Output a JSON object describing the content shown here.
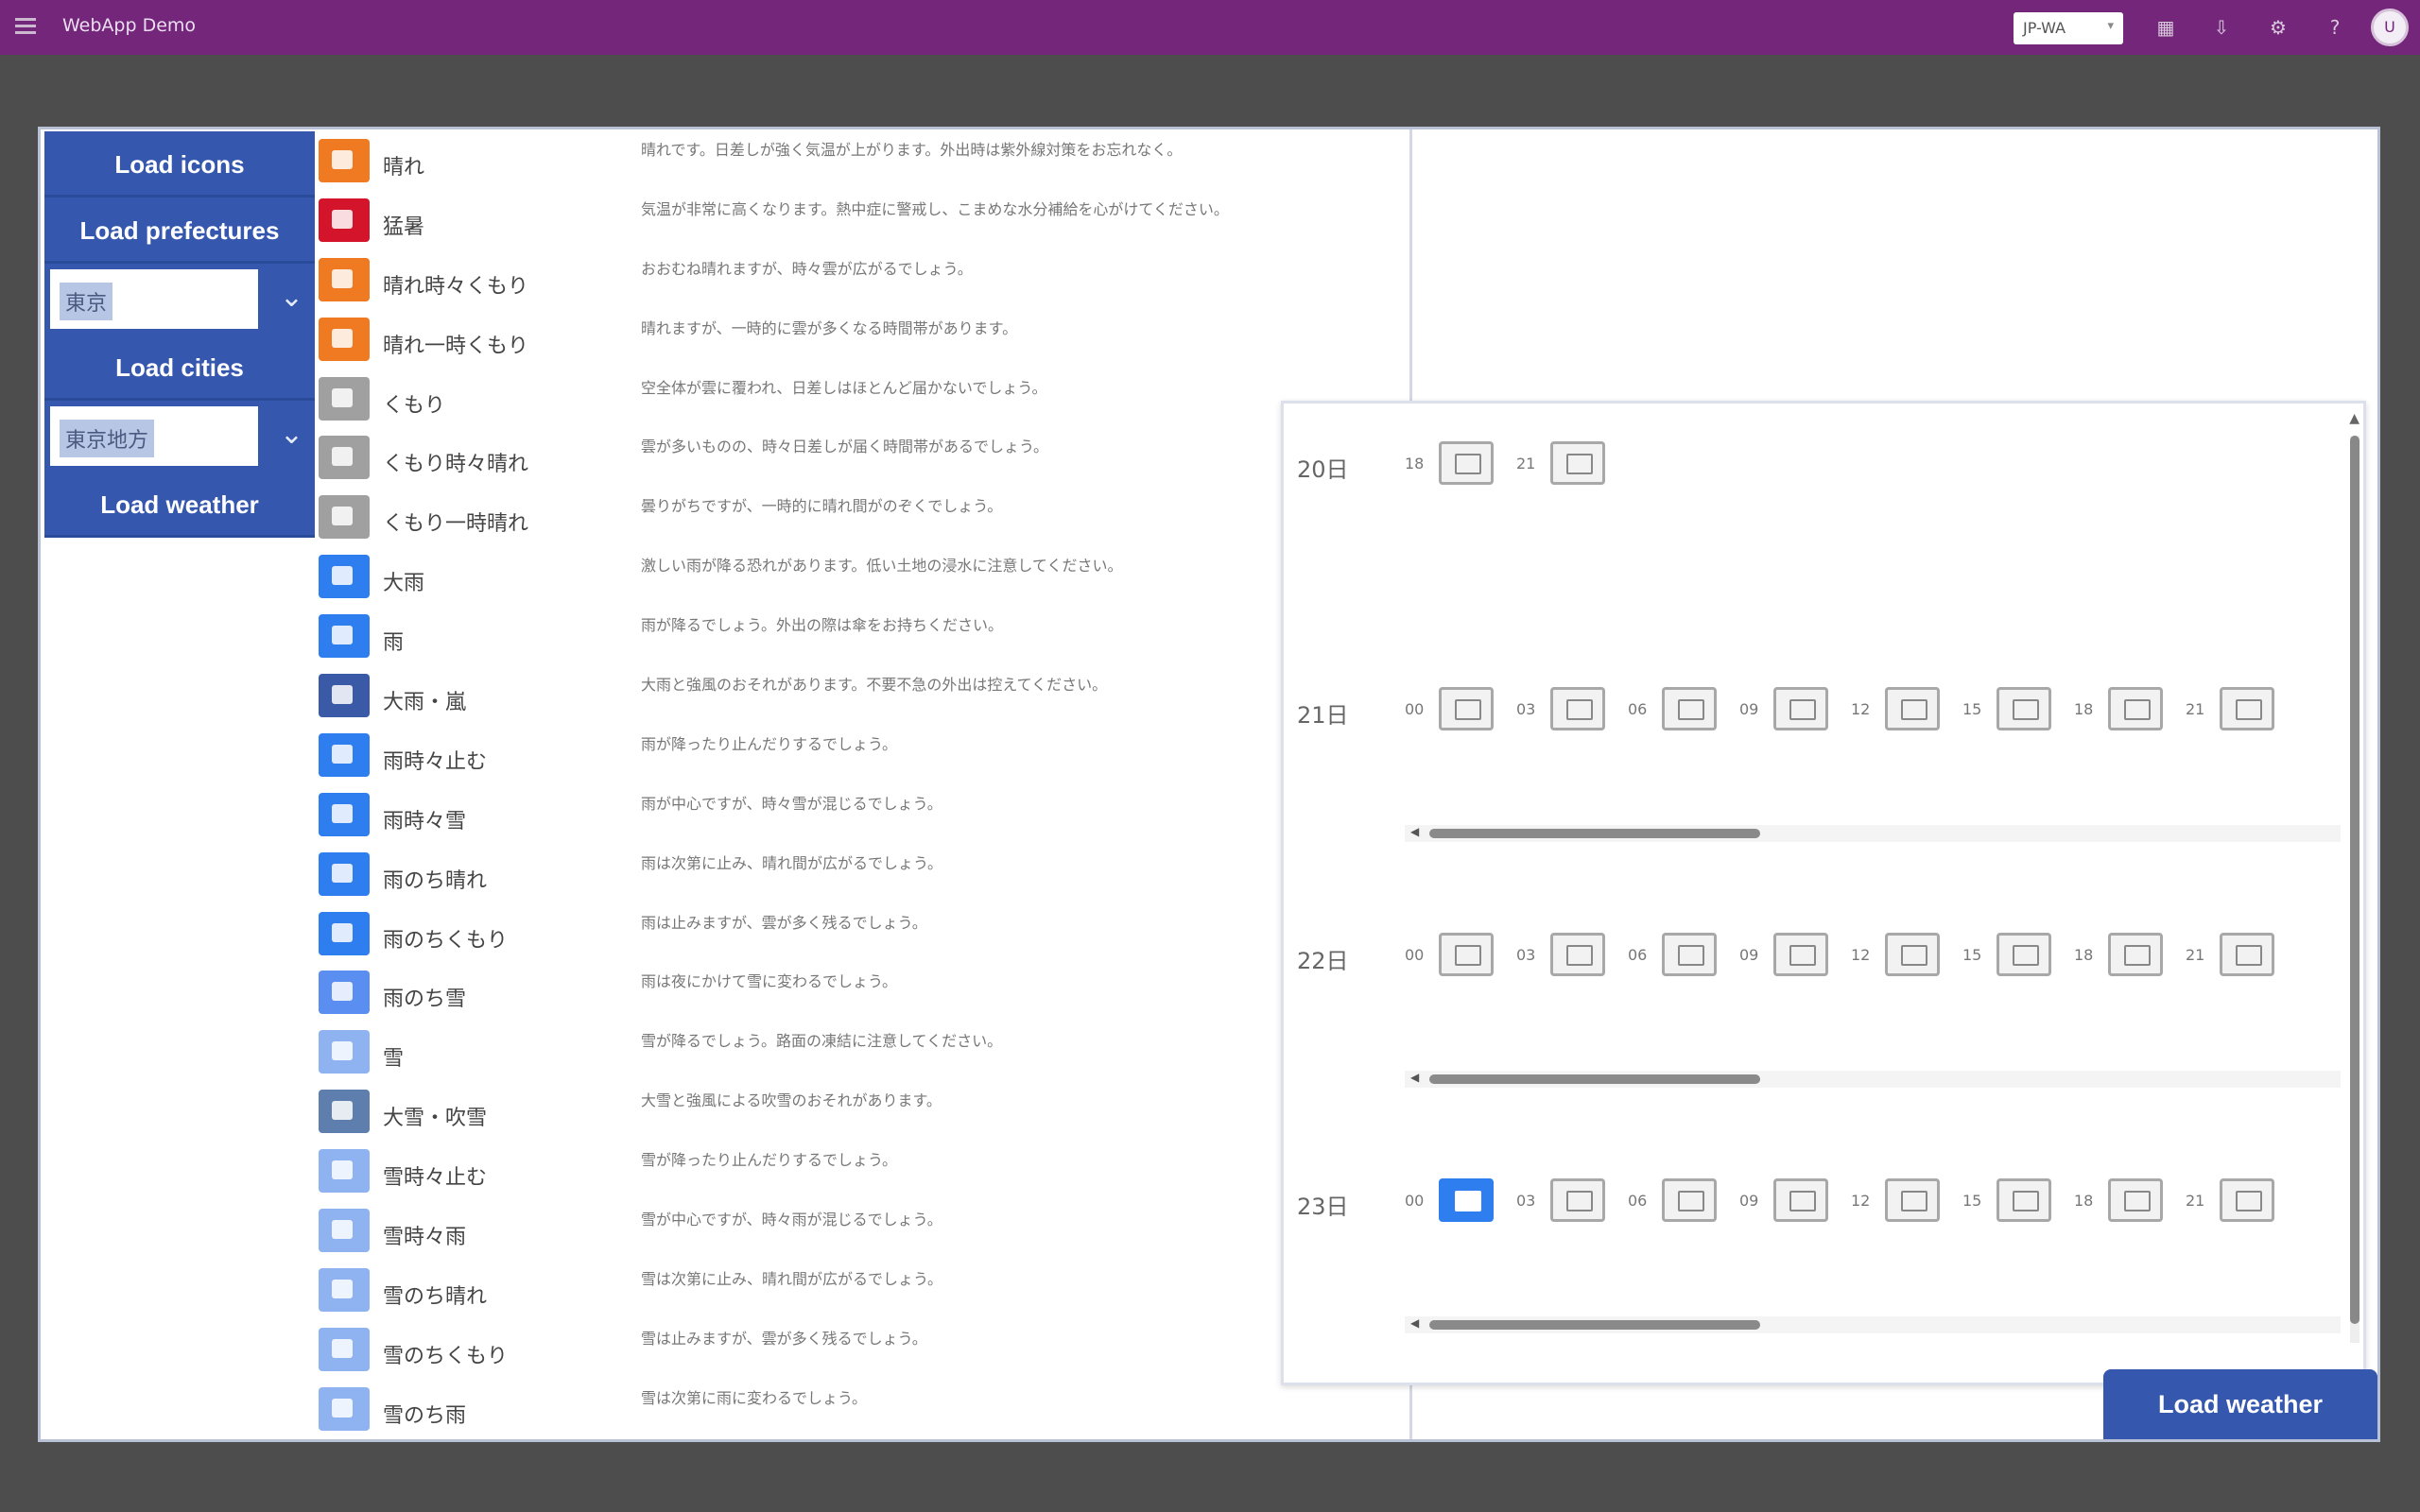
{
  "topbar": {
    "title": "WebApp Demo",
    "select_value": "JP-WA",
    "icons": [
      "grid-icon",
      "download-icon",
      "settings-icon",
      "help-icon"
    ],
    "avatar": "U"
  },
  "sidebar": {
    "load_icons": "Load icons",
    "load_prefectures": "Load prefectures",
    "prefecture_value": "東京",
    "load_cities": "Load cities",
    "city_value": "東京地方",
    "load_weather": "Load weather"
  },
  "icon_list": [
    {
      "name": "晴れ",
      "color": "#f07a22",
      "desc": "晴れです。日差しが強く気温が上がります。外出時は紫外線対策をお忘れなく。"
    },
    {
      "name": "猛暑",
      "color": "#d4142a",
      "desc": "気温が非常に高くなります。熱中症に警戒し、こまめな水分補給を心がけてください。"
    },
    {
      "name": "晴れ時々くもり",
      "color": "#f07a22",
      "desc": "おおむね晴れますが、時々雲が広がるでしょう。"
    },
    {
      "name": "晴れ一時くもり",
      "color": "#f07a22",
      "desc": "晴れますが、一時的に雲が多くなる時間帯があります。"
    },
    {
      "name": "くもり",
      "color": "#a0a0a0",
      "desc": "空全体が雲に覆われ、日差しはほとんど届かないでしょう。"
    },
    {
      "name": "くもり時々晴れ",
      "color": "#a0a0a0",
      "desc": "雲が多いものの、時々日差しが届く時間帯があるでしょう。"
    },
    {
      "name": "くもり一時晴れ",
      "color": "#a0a0a0",
      "desc": "曇りがちですが、一時的に晴れ間がのぞくでしょう。"
    },
    {
      "name": "大雨",
      "color": "#2f7ef0",
      "desc": "激しい雨が降る恐れがあります。低い土地の浸水に注意してください。"
    },
    {
      "name": "雨",
      "color": "#2f7ef0",
      "desc": "雨が降るでしょう。外出の際は傘をお持ちください。"
    },
    {
      "name": "大雨・嵐",
      "color": "#3a5aa8",
      "desc": "大雨と強風のおそれがあります。不要不急の外出は控えてください。"
    },
    {
      "name": "雨時々止む",
      "color": "#2f7ef0",
      "desc": "雨が降ったり止んだりするでしょう。"
    },
    {
      "name": "雨時々雪",
      "color": "#2f7ef0",
      "desc": "雨が中心ですが、時々雪が混じるでしょう。"
    },
    {
      "name": "雨のち晴れ",
      "color": "#2f7ef0",
      "desc": "雨は次第に止み、晴れ間が広がるでしょう。"
    },
    {
      "name": "雨のちくもり",
      "color": "#2f7ef0",
      "desc": "雨は止みますが、雲が多く残るでしょう。"
    },
    {
      "name": "雨のち雪",
      "color": "#5a8ef0",
      "desc": "雨は夜にかけて雪に変わるでしょう。"
    },
    {
      "name": "雪",
      "color": "#8fb2f0",
      "desc": "雪が降るでしょう。路面の凍結に注意してください。"
    },
    {
      "name": "大雪・吹雪",
      "color": "#5e7fae",
      "desc": "大雪と強風による吹雪のおそれがあります。"
    },
    {
      "name": "雪時々止む",
      "color": "#8fb2f0",
      "desc": "雪が降ったり止んだりするでしょう。"
    },
    {
      "name": "雪時々雨",
      "color": "#8fb2f0",
      "desc": "雪が中心ですが、時々雨が混じるでしょう。"
    },
    {
      "name": "雪のち晴れ",
      "color": "#8fb2f0",
      "desc": "雪は次第に止み、晴れ間が広がるでしょう。"
    },
    {
      "name": "雪のちくもり",
      "color": "#8fb2f0",
      "desc": "雪は止みますが、雲が多く残るでしょう。"
    },
    {
      "name": "雪のち雨",
      "color": "#8fb2f0",
      "desc": "雪は次第に雨に変わるでしょう。"
    }
  ],
  "forecast": {
    "days": [
      {
        "label": "20日",
        "hours": [
          "18",
          "21"
        ],
        "blue_index": -1
      },
      {
        "label": "21日",
        "hours": [
          "00",
          "03",
          "06",
          "09",
          "12",
          "15",
          "18",
          "21"
        ],
        "blue_index": -1
      },
      {
        "label": "22日",
        "hours": [
          "00",
          "03",
          "06",
          "09",
          "12",
          "15",
          "18",
          "21"
        ],
        "blue_index": -1
      },
      {
        "label": "23日",
        "hours": [
          "00",
          "03",
          "06",
          "09",
          "12",
          "15",
          "18",
          "21"
        ],
        "blue_index": 0
      }
    ]
  },
  "load_weather_bottom": "Load weather"
}
